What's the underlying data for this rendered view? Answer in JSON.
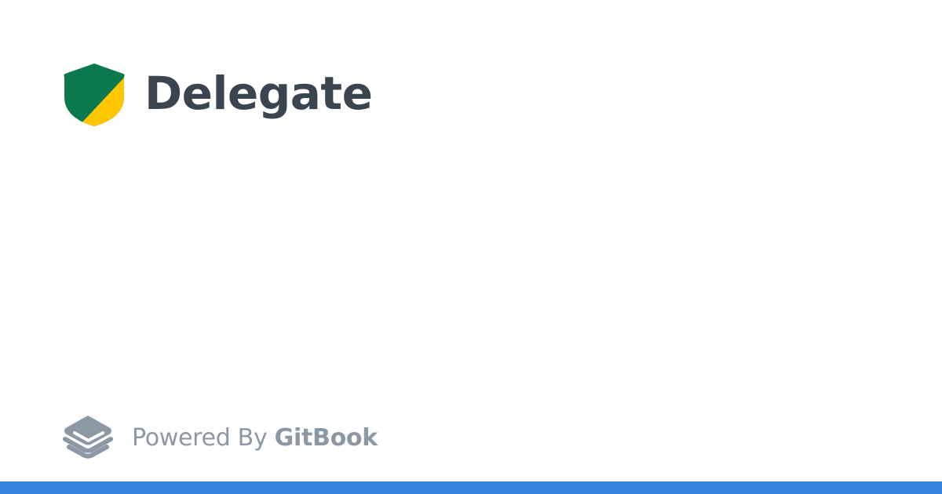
{
  "brand": {
    "title": "Delegate",
    "logo_icon": "shield-logo-icon",
    "logo_colors": {
      "green": "#0a7a4e",
      "yellow": "#ffc700"
    }
  },
  "footer": {
    "powered_prefix": "Powered By",
    "powered_brand": "GitBook",
    "icon": "gitbook-icon",
    "text_color": "#8c98a4"
  },
  "accent": {
    "bottom_bar_color": "#3382dc"
  }
}
